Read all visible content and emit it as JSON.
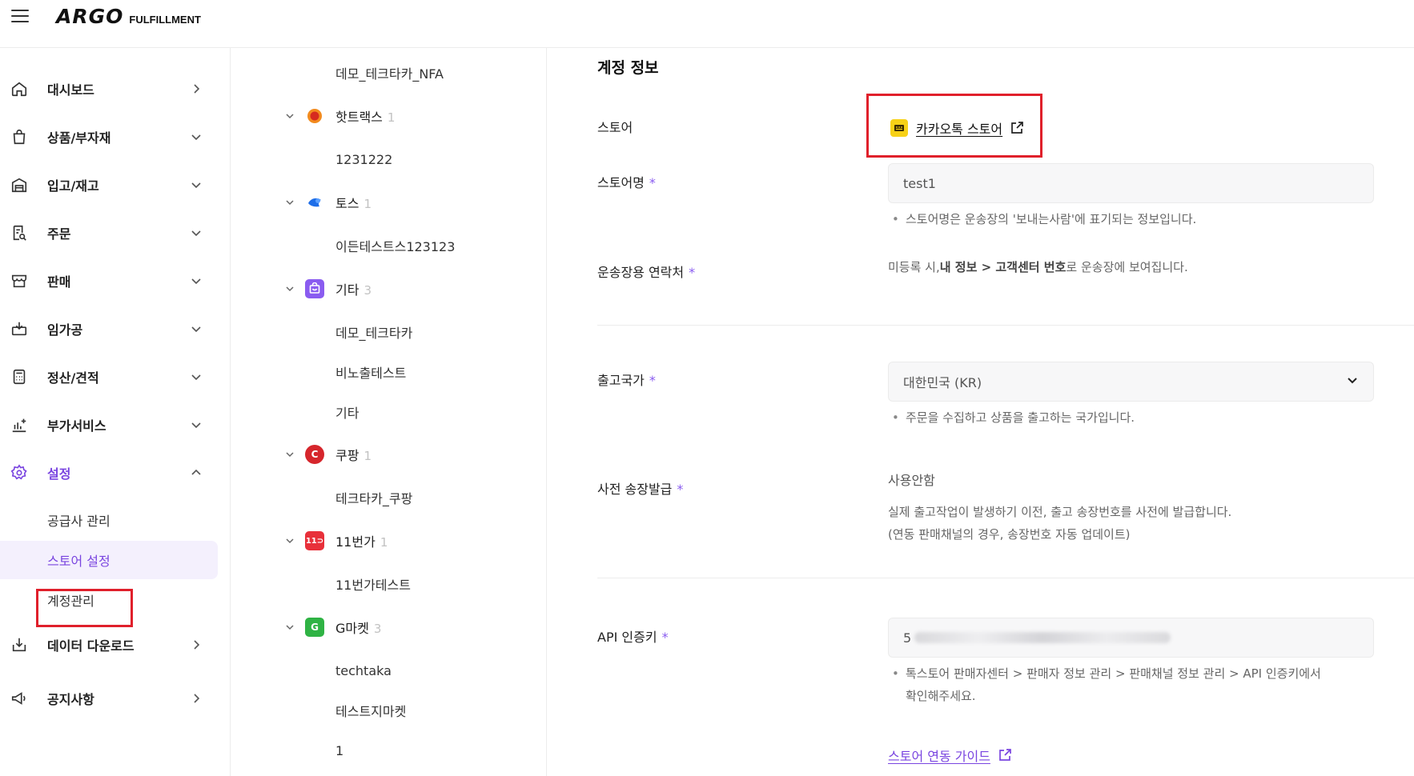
{
  "header": {
    "logo_main": "ARGO",
    "logo_sub": "FULFILLMENT"
  },
  "sidebar": {
    "items": [
      {
        "label": "대시보드",
        "icon": "home-icon",
        "chevron": "right"
      },
      {
        "label": "상품/부자재",
        "icon": "shopping-bag-icon",
        "chevron": "down"
      },
      {
        "label": "입고/재고",
        "icon": "warehouse-icon",
        "chevron": "down"
      },
      {
        "label": "주문",
        "icon": "order-list-icon",
        "chevron": "down"
      },
      {
        "label": "판매",
        "icon": "storefront-icon",
        "chevron": "down"
      },
      {
        "label": "임가공",
        "icon": "box-process-icon",
        "chevron": "down"
      },
      {
        "label": "정산/견적",
        "icon": "calculator-icon",
        "chevron": "down"
      },
      {
        "label": "부가서비스",
        "icon": "chart-plus-icon",
        "chevron": "down"
      },
      {
        "label": "설정",
        "icon": "gear-icon",
        "chevron": "up"
      },
      {
        "label": "데이터 다운로드",
        "icon": "download-icon",
        "chevron": "right"
      },
      {
        "label": "공지사항",
        "icon": "megaphone-icon",
        "chevron": "right"
      }
    ],
    "settings_sub": [
      {
        "label": "공급사 관리"
      },
      {
        "label": "스토어 설정"
      },
      {
        "label": "계정관리"
      }
    ]
  },
  "tree": {
    "top_child": "데모_테크타카_NFA",
    "groups": [
      {
        "name": "핫트랙스",
        "count": "1",
        "logo": "hottracks-logo-icon",
        "children": [
          "1231222"
        ]
      },
      {
        "name": "토스",
        "count": "1",
        "logo": "toss-logo-icon",
        "children": [
          "이든테스트스123123"
        ]
      },
      {
        "name": "기타",
        "count": "3",
        "logo": "etc-store-icon",
        "children": [
          "데모_테크타카",
          "비노출테스트",
          "기타"
        ]
      },
      {
        "name": "쿠팡",
        "count": "1",
        "logo": "coupang-logo-icon",
        "children": [
          "테크타카_쿠팡"
        ]
      },
      {
        "name": "11번가",
        "count": "1",
        "logo": "11st-logo-icon",
        "children": [
          "11번가테스트"
        ]
      },
      {
        "name": "G마켓",
        "count": "3",
        "logo": "gmarket-logo-icon",
        "children": [
          "techtaka",
          "테스트지마켓",
          "1"
        ]
      }
    ]
  },
  "form": {
    "section_title": "계정 정보",
    "store_label": "스토어",
    "store_link": "카카오톡 스토어",
    "store_name_label": "스토어명",
    "store_name_value": "test1",
    "store_name_hint": "스토어명은 운송장의 '보내는사람'에 표기되는 정보입니다.",
    "contact_label": "운송장용 연락처",
    "contact_hint_pre": "미등록 시,",
    "contact_hint_bold": "내 정보 > 고객센터 번호",
    "contact_hint_post": "로 운송장에 보여집니다.",
    "country_label": "출고국가",
    "country_value": "대한민국 (KR)",
    "country_hint": "주문을 수집하고 상품을 출고하는 국가입니다.",
    "preinvoice_label": "사전 송장발급",
    "preinvoice_value": "사용안함",
    "preinvoice_desc1": "실제 출고작업이 발생하기 이전, 출고 송장번호를 사전에 발급합니다.",
    "preinvoice_desc2": "(연동 판매채널의 경우, 송장번호 자동 업데이트)",
    "api_label": "API 인증키",
    "api_value_prefix": "5",
    "api_hint_line1": "톡스토어 판매자센터 > 판매자 정보 관리 > 판매채널 정보 관리 > API 인증키에서",
    "api_hint_line2": "확인해주세요.",
    "guide_link": "스토어 연동 가이드",
    "required_mark": "*"
  },
  "colors": {
    "accent": "#7a45e0",
    "highlight": "#e0202b",
    "kakao": "#f7d117"
  }
}
